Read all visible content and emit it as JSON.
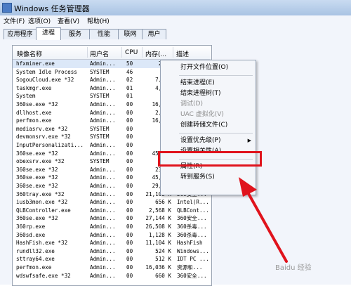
{
  "window": {
    "title": "Windows 任务管理器"
  },
  "menubar": [
    "文件(F)",
    "选项(O)",
    "查看(V)",
    "帮助(H)"
  ],
  "tabs": [
    {
      "label": "应用程序"
    },
    {
      "label": "进程",
      "active": true
    },
    {
      "label": "服务"
    },
    {
      "label": "性能"
    },
    {
      "label": "联网"
    },
    {
      "label": "用户"
    }
  ],
  "table": {
    "headers": {
      "name": "映像名称",
      "user": "用户名",
      "cpu": "CPU",
      "mem": "内存(...",
      "desc": "描述"
    },
    "rows": [
      {
        "name": "hfxminer.exe",
        "user": "Admin...",
        "cpu": "50",
        "mem": "2,74",
        "desc": ""
      },
      {
        "name": "System Idle Process",
        "user": "SYSTEM",
        "cpu": "46",
        "mem": "2",
        "desc": ""
      },
      {
        "name": "SogouCloud.exe *32",
        "user": "Admin...",
        "cpu": "02",
        "mem": "7,713",
        "desc": ""
      },
      {
        "name": "taskmgr.exe",
        "user": "Admin...",
        "cpu": "01",
        "mem": "4,828",
        "desc": ""
      },
      {
        "name": "System",
        "user": "SYSTEM",
        "cpu": "01",
        "mem": "60",
        "desc": ""
      },
      {
        "name": "360se.exe *32",
        "user": "Admin...",
        "cpu": "00",
        "mem": "16,396",
        "desc": ""
      },
      {
        "name": "dllhost.exe",
        "user": "Admin...",
        "cpu": "00",
        "mem": "2,488",
        "desc": ""
      },
      {
        "name": "perfmon.exe",
        "user": "Admin...",
        "cpu": "00",
        "mem": "16,236",
        "desc": ""
      },
      {
        "name": "mediasrv.exe *32",
        "user": "SYSTEM",
        "cpu": "00",
        "mem": "440",
        "desc": ""
      },
      {
        "name": "devmonsrv.exe *32",
        "user": "SYSTEM",
        "cpu": "00",
        "mem": "316",
        "desc": ""
      },
      {
        "name": "InputPersonalizati...",
        "user": "Admin...",
        "cpu": "00",
        "mem": "424",
        "desc": ""
      },
      {
        "name": "360se.exe *32",
        "user": "Admin...",
        "cpu": "00",
        "mem": "45,628",
        "desc": ""
      },
      {
        "name": "obexsrv.exe *32",
        "user": "SYSTEM",
        "cpu": "00",
        "mem": "5",
        "desc": ""
      },
      {
        "name": "360se.exe *32",
        "user": "Admin...",
        "cpu": "00",
        "mem": "23,72",
        "desc": ""
      },
      {
        "name": "360se.exe *32",
        "user": "Admin...",
        "cpu": "00",
        "mem": "45,452",
        "desc": ""
      },
      {
        "name": "360se.exe *32",
        "user": "Admin...",
        "cpu": "00",
        "mem": "29,472",
        "desc": ""
      },
      {
        "name": "360tray.exe *32",
        "user": "Admin...",
        "cpu": "00",
        "mem": "21,108 K",
        "desc": "360安全..."
      },
      {
        "name": "iusb3mon.exe *32",
        "user": "Admin...",
        "cpu": "00",
        "mem": "656 K",
        "desc": "Intel(R..."
      },
      {
        "name": "QLBController.exe",
        "user": "Admin...",
        "cpu": "00",
        "mem": "2,568 K",
        "desc": "QLBCont..."
      },
      {
        "name": "360se.exe *32",
        "user": "Admin...",
        "cpu": "00",
        "mem": "27,144 K",
        "desc": "360安全..."
      },
      {
        "name": "360rp.exe",
        "user": "Admin...",
        "cpu": "00",
        "mem": "26,508 K",
        "desc": "360杀毒..."
      },
      {
        "name": "360sd.exe",
        "user": "Admin...",
        "cpu": "00",
        "mem": "1,128 K",
        "desc": "360杀毒..."
      },
      {
        "name": "HashFish.exe *32",
        "user": "Admin...",
        "cpu": "00",
        "mem": "11,104 K",
        "desc": "HashFish"
      },
      {
        "name": "rundll32.exe",
        "user": "Admin...",
        "cpu": "00",
        "mem": "524 K",
        "desc": "Windows..."
      },
      {
        "name": "sttray64.exe",
        "user": "Admin...",
        "cpu": "00",
        "mem": "512 K",
        "desc": "IDT PC ..."
      },
      {
        "name": "perfmon.exe",
        "user": "Admin...",
        "cpu": "00",
        "mem": "16,036 K",
        "desc": "资源和..."
      },
      {
        "name": "wdswfsafe.exe *32",
        "user": "Admin...",
        "cpu": "00",
        "mem": "660 K",
        "desc": "360安全..."
      }
    ]
  },
  "context_menu": {
    "items": [
      {
        "label": "打开文件位置(O)"
      },
      {
        "sep": true
      },
      {
        "label": "结束进程(E)"
      },
      {
        "label": "结束进程树(T)"
      },
      {
        "label": "调试(D)",
        "disabled": true
      },
      {
        "label": "UAC 虚拟化(V)",
        "disabled": true
      },
      {
        "label": "创建转储文件(C)"
      },
      {
        "sep": true
      },
      {
        "label": "设置优先级(P)",
        "submenu": true
      },
      {
        "label": "设置相关性(A)...",
        "highlighted": true
      },
      {
        "sep": true
      },
      {
        "label": "属性(R)"
      },
      {
        "label": "转到服务(S)"
      }
    ]
  },
  "annotation": {
    "highlight_color": "#e0131c"
  },
  "watermark": "Baidu 经验"
}
